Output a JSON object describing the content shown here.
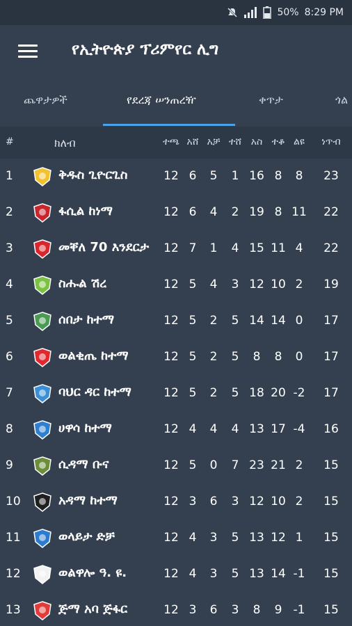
{
  "status_bar": {
    "battery": "50%",
    "time": "8:29 PM"
  },
  "app": {
    "title": "የኢትዮጵያ ፕሪምየር ሊግ"
  },
  "tabs": [
    {
      "label": "ጨዋታዎች",
      "active": false
    },
    {
      "label": "የደረጃ ሠንጠረዥ",
      "active": true
    },
    {
      "label": "ቀጥታ",
      "active": false
    },
    {
      "label": "ጎል",
      "active": false
    }
  ],
  "table": {
    "headers": {
      "pos": "#",
      "club": "ክለብ",
      "played": "ተጫ",
      "won": "አሸ",
      "drawn": "አቻ",
      "lost": "ተሸ",
      "gf": "አስ",
      "ga": "ተቆ",
      "gd": "ልዩ",
      "pts": "ነጥብ"
    },
    "rows": [
      {
        "pos": "1",
        "club": "ቅዱስ ጊዮርጊስ",
        "logo_color": "#f2c12e",
        "played": "12",
        "won": "6",
        "drawn": "5",
        "lost": "1",
        "gf": "16",
        "ga": "8",
        "gd": "8",
        "pts": "23"
      },
      {
        "pos": "2",
        "club": "ፋሲል ከነማ",
        "logo_color": "#c8262e",
        "played": "12",
        "won": "6",
        "drawn": "4",
        "lost": "2",
        "gf": "19",
        "ga": "8",
        "gd": "11",
        "pts": "22"
      },
      {
        "pos": "3",
        "club": "መቐለ 70 እንደርታ",
        "logo_color": "#d9262c",
        "played": "12",
        "won": "7",
        "drawn": "1",
        "lost": "4",
        "gf": "15",
        "ga": "11",
        "gd": "4",
        "pts": "22"
      },
      {
        "pos": "4",
        "club": "ስሑል ሽረ",
        "logo_color": "#7cc242",
        "played": "12",
        "won": "5",
        "drawn": "4",
        "lost": "3",
        "gf": "12",
        "ga": "10",
        "gd": "2",
        "pts": "19"
      },
      {
        "pos": "5",
        "club": "ሰበታ ከተማ",
        "logo_color": "#4a9c52",
        "played": "12",
        "won": "5",
        "drawn": "2",
        "lost": "5",
        "gf": "14",
        "ga": "14",
        "gd": "0",
        "pts": "17"
      },
      {
        "pos": "6",
        "club": "ወልቂጤ ከተማ",
        "logo_color": "#e0282e",
        "played": "12",
        "won": "5",
        "drawn": "2",
        "lost": "5",
        "gf": "8",
        "ga": "8",
        "gd": "0",
        "pts": "17"
      },
      {
        "pos": "7",
        "club": "ባህር ዳር ከተማ",
        "logo_color": "#3a8fd6",
        "played": "12",
        "won": "5",
        "drawn": "2",
        "lost": "5",
        "gf": "18",
        "ga": "20",
        "gd": "-2",
        "pts": "17"
      },
      {
        "pos": "8",
        "club": "ሀዋሳ ከተማ",
        "logo_color": "#2f7fd1",
        "played": "12",
        "won": "4",
        "drawn": "4",
        "lost": "4",
        "gf": "13",
        "ga": "17",
        "gd": "-4",
        "pts": "16"
      },
      {
        "pos": "9",
        "club": "ሲዳማ ቡና",
        "logo_color": "#6b8e3a",
        "played": "12",
        "won": "5",
        "drawn": "0",
        "lost": "7",
        "gf": "23",
        "ga": "21",
        "gd": "2",
        "pts": "15"
      },
      {
        "pos": "10",
        "club": "አዳማ ከተማ",
        "logo_color": "#1f1f1f",
        "played": "12",
        "won": "3",
        "drawn": "6",
        "lost": "3",
        "gf": "12",
        "ga": "10",
        "gd": "2",
        "pts": "15"
      },
      {
        "pos": "11",
        "club": "ወላይታ ድቻ",
        "logo_color": "#2b7bd0",
        "played": "12",
        "won": "4",
        "drawn": "3",
        "lost": "5",
        "gf": "13",
        "ga": "12",
        "gd": "1",
        "pts": "15"
      },
      {
        "pos": "12",
        "club": "ወልዋሎ ዓ. ዩ.",
        "logo_color": "#f2f2f2",
        "played": "12",
        "won": "4",
        "drawn": "3",
        "lost": "5",
        "gf": "13",
        "ga": "14",
        "gd": "-1",
        "pts": "15"
      },
      {
        "pos": "13",
        "club": "ጅማ አባ ጅፋር",
        "logo_color": "#e23b3b",
        "played": "12",
        "won": "3",
        "drawn": "6",
        "lost": "3",
        "gf": "8",
        "ga": "9",
        "gd": "-1",
        "pts": "15"
      }
    ]
  },
  "colors": {
    "background": "#344050",
    "header_bg": "#2e3948",
    "accent": "#4aa3e8"
  }
}
